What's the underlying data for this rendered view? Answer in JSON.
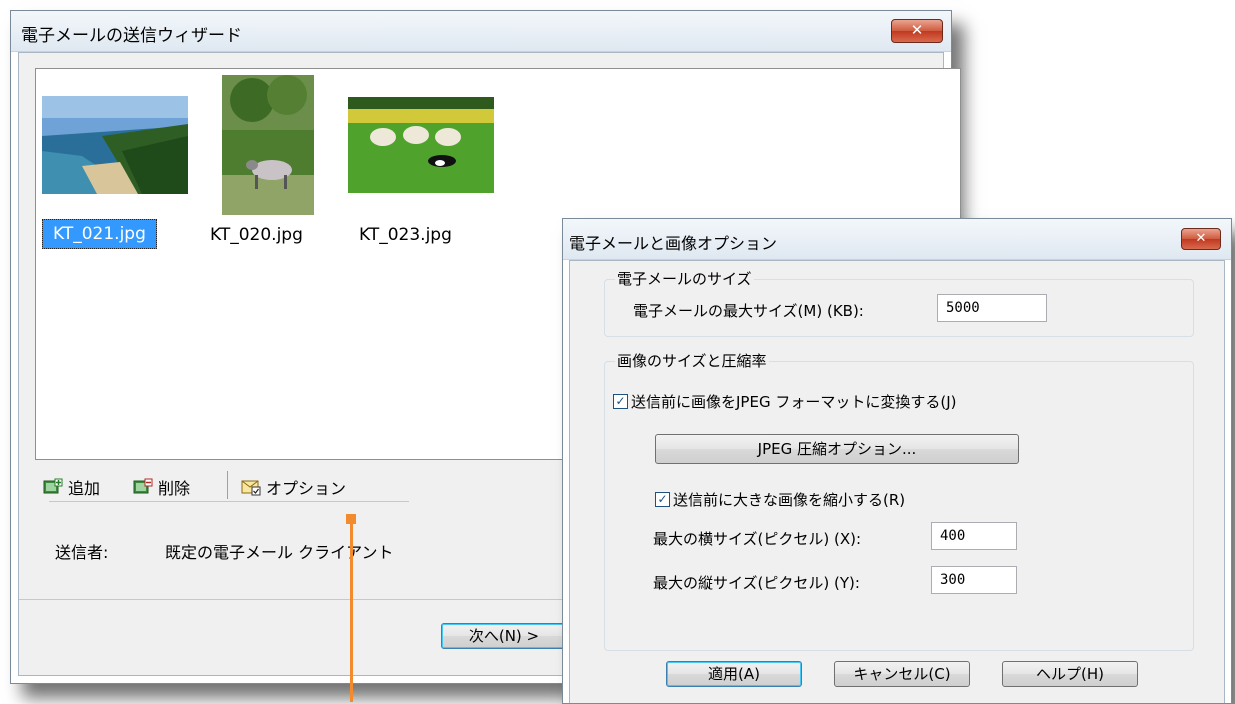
{
  "wizard": {
    "title": "電子メールの送信ウィザード",
    "close_label": "✕",
    "thumbnails": [
      {
        "filename": "KT_021.jpg",
        "selected": true
      },
      {
        "filename": "KT_020.jpg",
        "selected": false
      },
      {
        "filename": "KT_023.jpg",
        "selected": false
      }
    ],
    "toolbar": {
      "add_label": "追加",
      "delete_label": "削除",
      "options_label": "オプション"
    },
    "sender": {
      "label": "送信者:",
      "value": "既定の電子メール クライアント"
    },
    "next_button": "次へ(N) >"
  },
  "options_dialog": {
    "title": "電子メールと画像オプション",
    "close_label": "✕",
    "email_size_group": {
      "label": "電子メールのサイズ",
      "max_size_label": "電子メールの最大サイズ(M) (KB):",
      "max_size_value": "5000"
    },
    "image_group": {
      "label": "画像のサイズと圧縮率",
      "convert_jpeg_label": "送信前に画像をJPEG フォーマットに変換する(J)",
      "convert_jpeg_checked": true,
      "jpeg_options_button": "JPEG 圧縮オプション...",
      "shrink_label": "送信前に大きな画像を縮小する(R)",
      "shrink_checked": true,
      "max_width_label": "最大の横サイズ(ピクセル) (X):",
      "max_width_value": "400",
      "max_height_label": "最大の縦サイズ(ピクセル) (Y):",
      "max_height_value": "300"
    },
    "buttons": {
      "apply": "適用(A)",
      "cancel": "キャンセル(C)",
      "help": "ヘルプ(H)"
    }
  },
  "colors": {
    "selection": "#3399ff",
    "accent_marker": "#f28a2e",
    "close_button": "#c7432a"
  }
}
